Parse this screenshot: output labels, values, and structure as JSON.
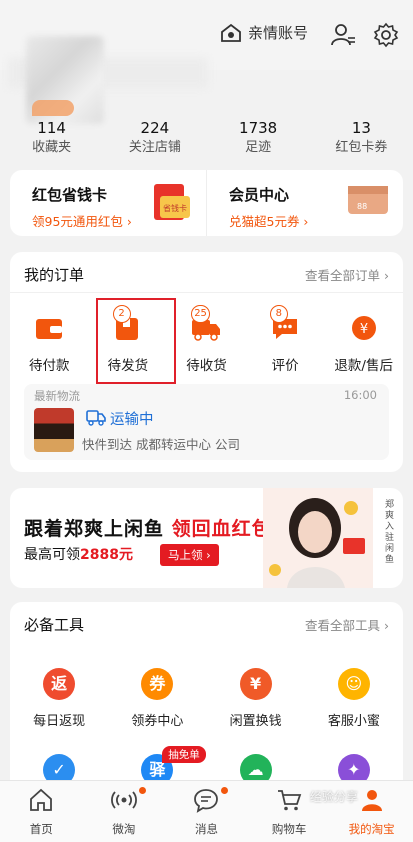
{
  "header": {
    "family_account": "亲情账号"
  },
  "stats": [
    {
      "num": "114",
      "label": "收藏夹"
    },
    {
      "num": "224",
      "label": "关注店铺"
    },
    {
      "num": "1738",
      "label": "足迹"
    },
    {
      "num": "13",
      "label": "红包卡券"
    }
  ],
  "promo": {
    "left": {
      "title": "红包省钱卡",
      "sub": "领95元通用红包 ›",
      "pic_text": "省钱卡"
    },
    "right": {
      "title": "会员中心",
      "sub": "兑猫超5元券 ›",
      "pic_text": "88"
    }
  },
  "orders": {
    "title": "我的订单",
    "more": "查看全部订单 ›",
    "items": [
      {
        "label": "待付款",
        "count": ""
      },
      {
        "label": "待发货",
        "count": "2"
      },
      {
        "label": "待收货",
        "count": "25"
      },
      {
        "label": "评价",
        "count": "8"
      },
      {
        "label": "退款/售后",
        "count": ""
      }
    ],
    "logistics": {
      "head": "最新物流",
      "time": "16:00",
      "status": "运输中",
      "detail": "快件到达 成都转运中心 公司"
    }
  },
  "banner": {
    "line1_a": "跟着郑爽上闲鱼 ",
    "line1_b": "领回血红包",
    "line2_a": "最高可领",
    "line2_b": "2888元",
    "button": "马上领 ›",
    "vertical": "郑爽入驻闲鱼"
  },
  "tools": {
    "title": "必备工具",
    "more": "查看全部工具 ›",
    "row1": [
      {
        "label": "每日返现",
        "glyph": "返",
        "color": "#ef4c2f"
      },
      {
        "label": "领券中心",
        "glyph": "券",
        "color": "#ff8a00"
      },
      {
        "label": "闲置换钱",
        "glyph": "¥",
        "color": "#f05a28"
      },
      {
        "label": "客服小蜜",
        "glyph": "☺",
        "color": "#ffb400"
      }
    ],
    "row2": [
      {
        "glyph": "✓",
        "color": "#2b8ef0"
      },
      {
        "glyph": "驿",
        "color": "#1e88f5",
        "badge": "抽免单"
      },
      {
        "glyph": "☁",
        "color": "#22b35a"
      },
      {
        "glyph": "✦",
        "color": "#8a4fd8"
      }
    ]
  },
  "tabbar": [
    {
      "label": "首页",
      "icon": "home-icon"
    },
    {
      "label": "微淘",
      "icon": "broadcast-icon"
    },
    {
      "label": "消息",
      "icon": "message-icon"
    },
    {
      "label": "购物车",
      "icon": "cart-icon"
    },
    {
      "label": "我的淘宝",
      "icon": "profile-icon"
    }
  ],
  "watermark": "经验分享"
}
